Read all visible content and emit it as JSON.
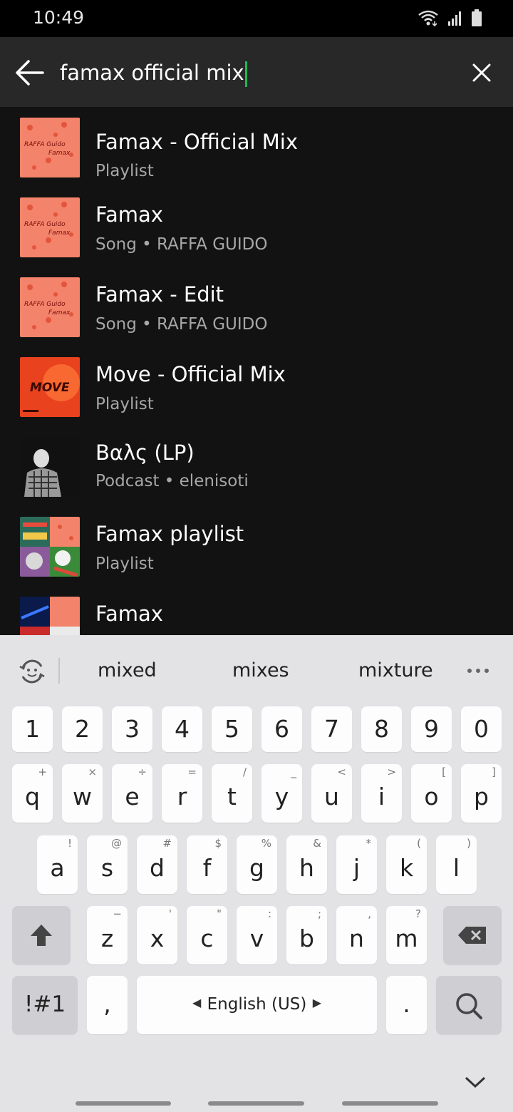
{
  "status": {
    "time": "10:49"
  },
  "search": {
    "query": "famax official mix"
  },
  "results": [
    {
      "title": "Famax - Official Mix",
      "subtitle": "Playlist",
      "art": "raffa"
    },
    {
      "title": "Famax",
      "subtitle": "Song • RAFFA GUIDO",
      "art": "raffa"
    },
    {
      "title": "Famax - Edit",
      "subtitle": "Song • RAFFA GUIDO",
      "art": "raffa"
    },
    {
      "title": "Move - Official Mix",
      "subtitle": "Playlist",
      "art": "move",
      "art_text": "MOVE"
    },
    {
      "title": "Βαλς (LP)",
      "subtitle": "Podcast • elenisoti",
      "art": "bw"
    },
    {
      "title": "Famax playlist",
      "subtitle": "Playlist",
      "art": "mosaic"
    },
    {
      "title": "Famax",
      "subtitle": "",
      "art": "mosaic2"
    }
  ],
  "art_labels": {
    "raffa_top": "RAFFA Guido",
    "raffa_mid": "Famax"
  },
  "keyboard": {
    "suggestions": [
      "mixed",
      "mixes",
      "mixture"
    ],
    "row_numbers": [
      "1",
      "2",
      "3",
      "4",
      "5",
      "6",
      "7",
      "8",
      "9",
      "0"
    ],
    "row1": [
      {
        "k": "q",
        "a": "+"
      },
      {
        "k": "w",
        "a": "×"
      },
      {
        "k": "e",
        "a": "÷"
      },
      {
        "k": "r",
        "a": "="
      },
      {
        "k": "t",
        "a": "/"
      },
      {
        "k": "y",
        "a": "_"
      },
      {
        "k": "u",
        "a": "<"
      },
      {
        "k": "i",
        "a": ">"
      },
      {
        "k": "o",
        "a": "["
      },
      {
        "k": "p",
        "a": "]"
      }
    ],
    "row2": [
      {
        "k": "a",
        "a": "!"
      },
      {
        "k": "s",
        "a": "@"
      },
      {
        "k": "d",
        "a": "#"
      },
      {
        "k": "f",
        "a": "$"
      },
      {
        "k": "g",
        "a": "%"
      },
      {
        "k": "h",
        "a": "&"
      },
      {
        "k": "j",
        "a": "*"
      },
      {
        "k": "k",
        "a": "("
      },
      {
        "k": "l",
        "a": ")"
      }
    ],
    "row3": [
      {
        "k": "z",
        "a": "−"
      },
      {
        "k": "x",
        "a": "'"
      },
      {
        "k": "c",
        "a": "\""
      },
      {
        "k": "v",
        "a": ":"
      },
      {
        "k": "b",
        "a": ";"
      },
      {
        "k": "n",
        "a": ","
      },
      {
        "k": "m",
        "a": "?"
      }
    ],
    "symbols_label": "!#1",
    "comma_label": ",",
    "space_label": "English (US)",
    "period_label": "."
  },
  "colors": {
    "background": "#121212",
    "search_bar": "#282828",
    "accent": "#1db954",
    "keyboard": "#e3e3e6"
  }
}
